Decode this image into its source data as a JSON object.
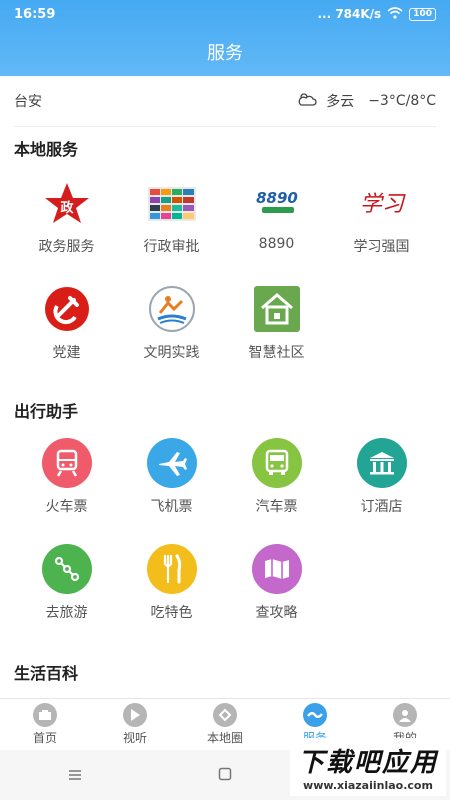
{
  "status": {
    "time": "16:59",
    "network": "... 784K/s",
    "battery": "100"
  },
  "title": "服务",
  "weather": {
    "city": "台安",
    "condition": "多云",
    "temp": "−3°C/8°C"
  },
  "sections": {
    "local": "本地服务",
    "travel": "出行助手",
    "life": "生活百科"
  },
  "local_services": [
    {
      "label": "政务服务",
      "icon": "star-gov-icon"
    },
    {
      "label": "行政审批",
      "icon": "approval-grid-icon"
    },
    {
      "label": "8890",
      "icon": "hotline-8890-icon",
      "logo_text": "8890"
    },
    {
      "label": "学习强国",
      "icon": "xuexi-logo-icon",
      "logo_text": "学习"
    },
    {
      "label": "党建",
      "icon": "party-emblem-icon"
    },
    {
      "label": "文明实践",
      "icon": "civilization-practice-icon"
    },
    {
      "label": "智慧社区",
      "icon": "community-house-icon"
    }
  ],
  "travel_services": [
    {
      "label": "火车票",
      "icon": "train-icon",
      "color": "#ef5b6b"
    },
    {
      "label": "飞机票",
      "icon": "airplane-icon",
      "color": "#3aa8e6"
    },
    {
      "label": "汽车票",
      "icon": "bus-icon",
      "color": "#86c442"
    },
    {
      "label": "订酒店",
      "icon": "hotel-icon",
      "color": "#22a595"
    },
    {
      "label": "去旅游",
      "icon": "route-icon",
      "color": "#4cb34f"
    },
    {
      "label": "吃特色",
      "icon": "fork-knife-icon",
      "color": "#f3bd1b"
    },
    {
      "label": "查攻略",
      "icon": "map-book-icon",
      "color": "#c468cc"
    }
  ],
  "tabs": [
    {
      "label": "首页",
      "icon": "home-tab-icon",
      "active": false
    },
    {
      "label": "视听",
      "icon": "play-tab-icon",
      "active": false
    },
    {
      "label": "本地圈",
      "icon": "local-circle-tab-icon",
      "active": false
    },
    {
      "label": "服务",
      "icon": "service-tab-icon",
      "active": true
    },
    {
      "label": "我的",
      "icon": "profile-tab-icon",
      "active": false
    }
  ],
  "watermark": {
    "main": "下载吧应用",
    "sub": "www.xiazaiinlao.com"
  }
}
